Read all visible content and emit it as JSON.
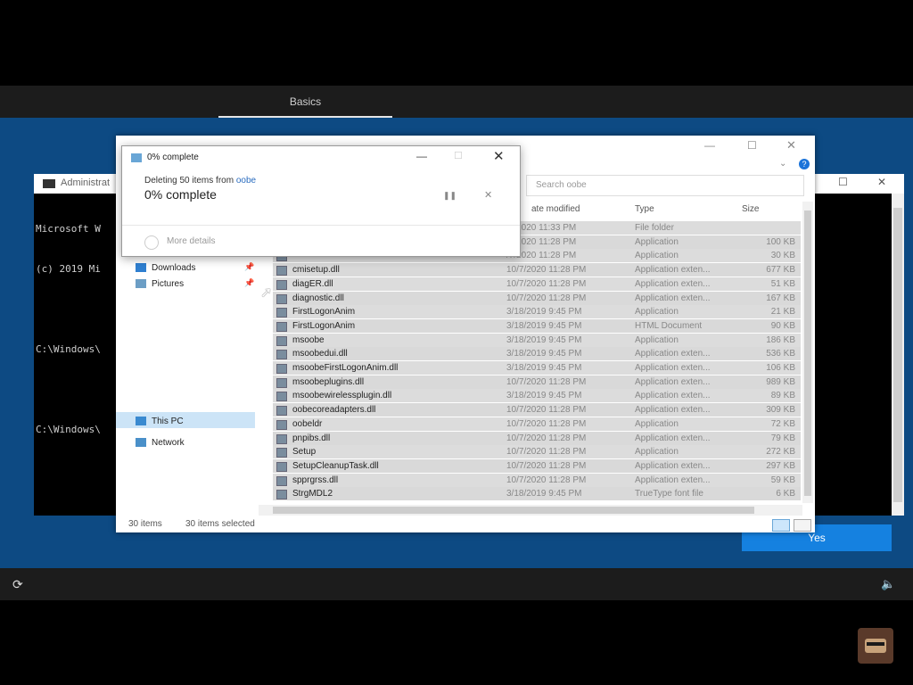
{
  "oobe": {
    "tab_label": "Basics",
    "yes_label": "Yes"
  },
  "cmd": {
    "title": "Administrat",
    "lines": [
      "Microsoft W",
      "(c) 2019 Mi",
      "",
      "C:\\Windows\\",
      "",
      "C:\\Windows\\"
    ]
  },
  "explorer": {
    "search_placeholder": "Search oobe",
    "nav": {
      "downloads": "Downloads",
      "pictures": "Pictures",
      "this_pc": "This PC",
      "network": "Network"
    },
    "columns": {
      "date": "ate modified",
      "type": "Type",
      "size": "Size"
    },
    "files": [
      {
        "name": "",
        "date": "/7/2020 11:33 PM",
        "type": "File folder",
        "size": ""
      },
      {
        "name": "",
        "date": "/7/2020 11:28 PM",
        "type": "Application",
        "size": "100 KB"
      },
      {
        "name": "",
        "date": "/7/2020 11:28 PM",
        "type": "Application",
        "size": "30 KB"
      },
      {
        "name": "cmisetup.dll",
        "date": "10/7/2020 11:28 PM",
        "type": "Application exten...",
        "size": "677 KB"
      },
      {
        "name": "diagER.dll",
        "date": "10/7/2020 11:28 PM",
        "type": "Application exten...",
        "size": "51 KB"
      },
      {
        "name": "diagnostic.dll",
        "date": "10/7/2020 11:28 PM",
        "type": "Application exten...",
        "size": "167 KB"
      },
      {
        "name": "FirstLogonAnim",
        "date": "3/18/2019 9:45 PM",
        "type": "Application",
        "size": "21 KB"
      },
      {
        "name": "FirstLogonAnim",
        "date": "3/18/2019 9:45 PM",
        "type": "HTML Document",
        "size": "90 KB"
      },
      {
        "name": "msoobe",
        "date": "3/18/2019 9:45 PM",
        "type": "Application",
        "size": "186 KB"
      },
      {
        "name": "msoobedui.dll",
        "date": "3/18/2019 9:45 PM",
        "type": "Application exten...",
        "size": "536 KB"
      },
      {
        "name": "msoobeFirstLogonAnim.dll",
        "date": "3/18/2019 9:45 PM",
        "type": "Application exten...",
        "size": "106 KB"
      },
      {
        "name": "msoobeplugins.dll",
        "date": "10/7/2020 11:28 PM",
        "type": "Application exten...",
        "size": "989 KB"
      },
      {
        "name": "msoobewirelessplugin.dll",
        "date": "3/18/2019 9:45 PM",
        "type": "Application exten...",
        "size": "89 KB"
      },
      {
        "name": "oobecoreadapters.dll",
        "date": "10/7/2020 11:28 PM",
        "type": "Application exten...",
        "size": "309 KB"
      },
      {
        "name": "oobeldr",
        "date": "10/7/2020 11:28 PM",
        "type": "Application",
        "size": "72 KB"
      },
      {
        "name": "pnpibs.dll",
        "date": "10/7/2020 11:28 PM",
        "type": "Application exten...",
        "size": "79 KB"
      },
      {
        "name": "Setup",
        "date": "10/7/2020 11:28 PM",
        "type": "Application",
        "size": "272 KB"
      },
      {
        "name": "SetupCleanupTask.dll",
        "date": "10/7/2020 11:28 PM",
        "type": "Application exten...",
        "size": "297 KB"
      },
      {
        "name": "spprgrss.dll",
        "date": "10/7/2020 11:28 PM",
        "type": "Application exten...",
        "size": "59 KB"
      },
      {
        "name": "StrgMDL2",
        "date": "3/18/2019 9:45 PM",
        "type": "TrueType font file",
        "size": "6 KB"
      }
    ],
    "status": {
      "items": "30 items",
      "selected": "30 items selected"
    }
  },
  "progress": {
    "title": "0% complete",
    "line_prefix": "Deleting 50 items from",
    "line_link": "oobe",
    "percent": "0% complete",
    "more_details": "More details"
  },
  "icons": {
    "ease": "ease-of-access-icon",
    "volume": "volume-icon"
  }
}
